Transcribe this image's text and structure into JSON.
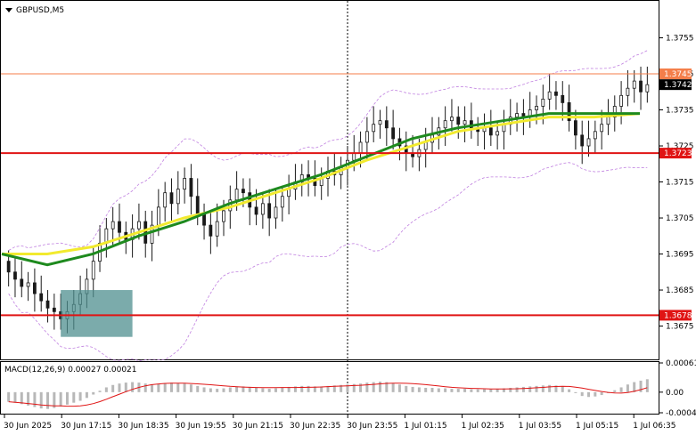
{
  "chart_data": {
    "type": "candlestick",
    "symbol": "GBPUSD,M5",
    "price_axis": {
      "ylim": [
        1.3666,
        1.3765
      ],
      "ticks": [
        "1.3755",
        "1.3745",
        "1.3735",
        "1.3725",
        "1.3715",
        "1.3705",
        "1.3695",
        "1.3685",
        "1.3675"
      ],
      "tick_values": [
        1.3755,
        1.3745,
        1.3735,
        1.3725,
        1.3715,
        1.3705,
        1.3695,
        1.3685,
        1.3675
      ],
      "current_price": "1.3742"
    },
    "time_labels": [
      "30 Jun 2025",
      "30 Jun 17:15",
      "30 Jun 18:35",
      "30 Jun 19:55",
      "30 Jun 21:15",
      "30 Jun 22:35",
      "30 Jun 23:55",
      "1 Jul 01:15",
      "1 Jul 02:35",
      "1 Jul 03:55",
      "1 Jul 05:15",
      "1 Jul 06:35"
    ],
    "levels": [
      {
        "label": "1.3745",
        "value": 1.3745,
        "color": "#f47e4a"
      },
      {
        "label": "1.3723",
        "value": 1.3723,
        "color": "#e01414"
      },
      {
        "label": "1.3678",
        "value": 1.3678,
        "color": "#e01414"
      }
    ],
    "close_series": [
      1.369,
      1.3688,
      1.3686,
      1.3687,
      1.3684,
      1.3682,
      1.368,
      1.3679,
      1.3677,
      1.3679,
      1.3681,
      1.3684,
      1.3688,
      1.3693,
      1.3698,
      1.3702,
      1.3704,
      1.3701,
      1.3699,
      1.3702,
      1.3704,
      1.3698,
      1.3703,
      1.3708,
      1.3712,
      1.3709,
      1.3713,
      1.3716,
      1.3711,
      1.3706,
      1.3703,
      1.37,
      1.3704,
      1.3707,
      1.371,
      1.3713,
      1.3712,
      1.3708,
      1.3706,
      1.3709,
      1.3705,
      1.3708,
      1.3711,
      1.3713,
      1.3715,
      1.3717,
      1.3716,
      1.3714,
      1.3716,
      1.3718,
      1.3717,
      1.3719,
      1.3721,
      1.3723,
      1.3726,
      1.3729,
      1.3731,
      1.3732,
      1.373,
      1.3727,
      1.3725,
      1.3723,
      1.3722,
      1.3724,
      1.3726,
      1.3728,
      1.373,
      1.3732,
      1.3733,
      1.3731,
      1.3732,
      1.373,
      1.3729,
      1.373,
      1.3728,
      1.3729,
      1.3731,
      1.3733,
      1.3734,
      1.3733,
      1.3735,
      1.3736,
      1.3738,
      1.374,
      1.3739,
      1.3737,
      1.3732,
      1.3728,
      1.3725,
      1.3727,
      1.3729,
      1.3731,
      1.3733,
      1.3736,
      1.3739,
      1.3741,
      1.3743,
      1.374,
      1.3742
    ],
    "ma_fast": {
      "color": "#f2ea2e",
      "values": [
        1.3695,
        1.3695,
        1.3697,
        1.3701,
        1.3705,
        1.3708,
        1.3712,
        1.3716,
        1.3721,
        1.3725,
        1.3729,
        1.3731,
        1.3733,
        1.3733,
        1.3734
      ]
    },
    "ma_slow": {
      "color": "#1e8a1e",
      "values": [
        1.3695,
        1.3692,
        1.3695,
        1.37,
        1.3704,
        1.3709,
        1.3713,
        1.3717,
        1.3722,
        1.3727,
        1.373,
        1.3732,
        1.3734,
        1.3734,
        1.3734
      ]
    },
    "macd": {
      "label": "MACD(12,26,9) 0.00027 0.00021",
      "ylim": [
        -0.00043,
        0.00061
      ],
      "ticks": [
        "0.00061",
        "0.00",
        "-0.00043"
      ],
      "tick_values": [
        0.00061,
        0.0,
        -0.00043
      ],
      "hist": [
        -0.0002,
        -0.00022,
        -0.00025,
        -0.00028,
        -0.00031,
        -0.00034,
        -0.00035,
        -0.00033,
        -0.0003,
        -0.00026,
        -0.00022,
        -0.00018,
        -0.00012,
        -5e-05,
        3e-05,
        0.0001,
        0.00015,
        0.00018,
        0.0002,
        0.00021,
        0.0002,
        0.00018,
        0.00016,
        0.00017,
        0.00019,
        0.0002,
        0.00019,
        0.00018,
        0.00016,
        0.00013,
        0.0001,
        8e-05,
        7e-05,
        8e-05,
        0.0001,
        0.00012,
        0.00012,
        0.00011,
        9e-05,
        8e-05,
        7e-05,
        8e-05,
        0.0001,
        0.00011,
        0.00012,
        0.00013,
        0.00013,
        0.00012,
        0.00012,
        0.00013,
        0.00014,
        0.00015,
        0.00016,
        0.00017,
        0.00018,
        0.0002,
        0.00021,
        0.00022,
        0.00021,
        0.00019,
        0.00016,
        0.00013,
        0.00011,
        0.0001,
        9e-05,
        9e-05,
        8e-05,
        8e-05,
        7e-05,
        7e-05,
        7e-05,
        6e-05,
        6e-05,
        6e-05,
        6e-05,
        7e-05,
        8e-05,
        9e-05,
        0.0001,
        0.00011,
        0.00012,
        0.00013,
        0.00014,
        0.00015,
        0.00014,
        0.00012,
        6e-05,
        -2e-05,
        -8e-05,
        -0.0001,
        -9e-05,
        -6e-05,
        -2e-05,
        4e-05,
        0.0001,
        0.00016,
        0.00021,
        0.00024,
        0.00027
      ],
      "signal_color": "#e01414",
      "hist_color": "#b8b8b8"
    },
    "colors": {
      "bull": "#1a1a1a",
      "bear": "#1a1a1a",
      "bollinger": "#c080e0",
      "box": "#4f8f8f",
      "grid": "#000000",
      "price_tag": "#f47e4a",
      "level_tag": "#e01414"
    }
  }
}
